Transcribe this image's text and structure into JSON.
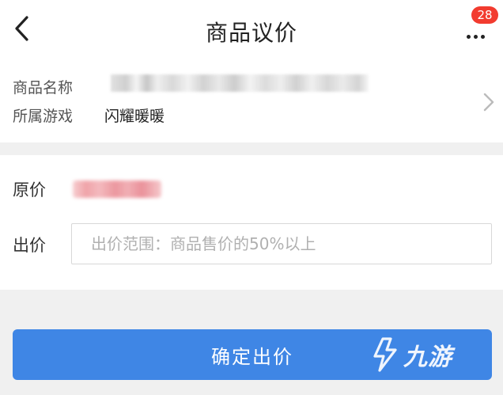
{
  "header": {
    "title": "商品议价",
    "back_icon": "chevron-left-icon",
    "more_icon": "more-dots-icon",
    "badge_count": "28"
  },
  "info": {
    "name_label": "商品名称",
    "game_label": "所属游戏",
    "game_value": "闪耀暖暖"
  },
  "price": {
    "original_label": "原价",
    "bid_label": "出价",
    "bid_placeholder": "出价范围：商品售价的50%以上",
    "bid_value": ""
  },
  "actions": {
    "confirm_label": "确定出价"
  },
  "watermark": {
    "text": "九游"
  },
  "colors": {
    "accent": "#3f86e5",
    "badge": "#f23b2f",
    "page_bg": "#f0f0f0"
  }
}
